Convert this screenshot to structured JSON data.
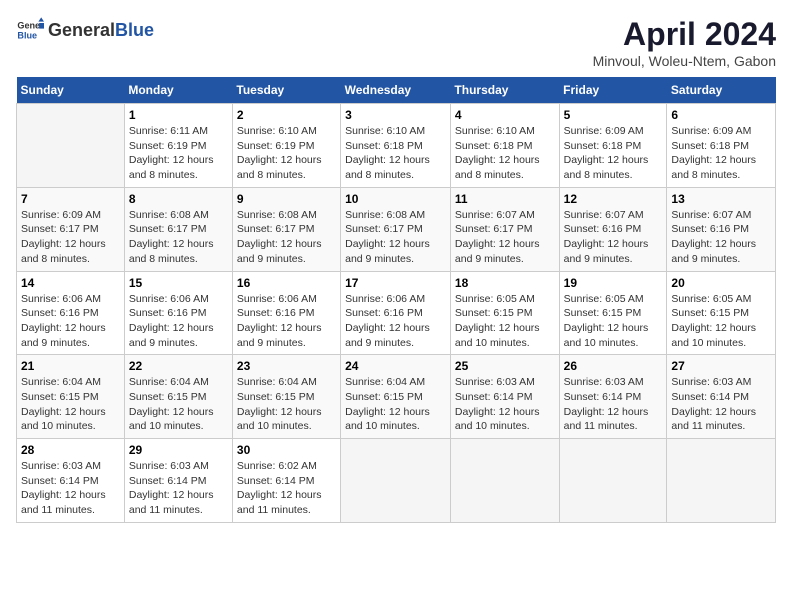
{
  "header": {
    "logo_general": "General",
    "logo_blue": "Blue",
    "title": "April 2024",
    "subtitle": "Minvoul, Woleu-Ntem, Gabon"
  },
  "days_of_week": [
    "Sunday",
    "Monday",
    "Tuesday",
    "Wednesday",
    "Thursday",
    "Friday",
    "Saturday"
  ],
  "weeks": [
    [
      {
        "day": "",
        "sunrise": "",
        "sunset": "",
        "daylight": ""
      },
      {
        "day": "1",
        "sunrise": "Sunrise: 6:11 AM",
        "sunset": "Sunset: 6:19 PM",
        "daylight": "Daylight: 12 hours and 8 minutes."
      },
      {
        "day": "2",
        "sunrise": "Sunrise: 6:10 AM",
        "sunset": "Sunset: 6:19 PM",
        "daylight": "Daylight: 12 hours and 8 minutes."
      },
      {
        "day": "3",
        "sunrise": "Sunrise: 6:10 AM",
        "sunset": "Sunset: 6:18 PM",
        "daylight": "Daylight: 12 hours and 8 minutes."
      },
      {
        "day": "4",
        "sunrise": "Sunrise: 6:10 AM",
        "sunset": "Sunset: 6:18 PM",
        "daylight": "Daylight: 12 hours and 8 minutes."
      },
      {
        "day": "5",
        "sunrise": "Sunrise: 6:09 AM",
        "sunset": "Sunset: 6:18 PM",
        "daylight": "Daylight: 12 hours and 8 minutes."
      },
      {
        "day": "6",
        "sunrise": "Sunrise: 6:09 AM",
        "sunset": "Sunset: 6:18 PM",
        "daylight": "Daylight: 12 hours and 8 minutes."
      }
    ],
    [
      {
        "day": "7",
        "sunrise": "Sunrise: 6:09 AM",
        "sunset": "Sunset: 6:17 PM",
        "daylight": "Daylight: 12 hours and 8 minutes."
      },
      {
        "day": "8",
        "sunrise": "Sunrise: 6:08 AM",
        "sunset": "Sunset: 6:17 PM",
        "daylight": "Daylight: 12 hours and 8 minutes."
      },
      {
        "day": "9",
        "sunrise": "Sunrise: 6:08 AM",
        "sunset": "Sunset: 6:17 PM",
        "daylight": "Daylight: 12 hours and 9 minutes."
      },
      {
        "day": "10",
        "sunrise": "Sunrise: 6:08 AM",
        "sunset": "Sunset: 6:17 PM",
        "daylight": "Daylight: 12 hours and 9 minutes."
      },
      {
        "day": "11",
        "sunrise": "Sunrise: 6:07 AM",
        "sunset": "Sunset: 6:17 PM",
        "daylight": "Daylight: 12 hours and 9 minutes."
      },
      {
        "day": "12",
        "sunrise": "Sunrise: 6:07 AM",
        "sunset": "Sunset: 6:16 PM",
        "daylight": "Daylight: 12 hours and 9 minutes."
      },
      {
        "day": "13",
        "sunrise": "Sunrise: 6:07 AM",
        "sunset": "Sunset: 6:16 PM",
        "daylight": "Daylight: 12 hours and 9 minutes."
      }
    ],
    [
      {
        "day": "14",
        "sunrise": "Sunrise: 6:06 AM",
        "sunset": "Sunset: 6:16 PM",
        "daylight": "Daylight: 12 hours and 9 minutes."
      },
      {
        "day": "15",
        "sunrise": "Sunrise: 6:06 AM",
        "sunset": "Sunset: 6:16 PM",
        "daylight": "Daylight: 12 hours and 9 minutes."
      },
      {
        "day": "16",
        "sunrise": "Sunrise: 6:06 AM",
        "sunset": "Sunset: 6:16 PM",
        "daylight": "Daylight: 12 hours and 9 minutes."
      },
      {
        "day": "17",
        "sunrise": "Sunrise: 6:06 AM",
        "sunset": "Sunset: 6:16 PM",
        "daylight": "Daylight: 12 hours and 9 minutes."
      },
      {
        "day": "18",
        "sunrise": "Sunrise: 6:05 AM",
        "sunset": "Sunset: 6:15 PM",
        "daylight": "Daylight: 12 hours and 10 minutes."
      },
      {
        "day": "19",
        "sunrise": "Sunrise: 6:05 AM",
        "sunset": "Sunset: 6:15 PM",
        "daylight": "Daylight: 12 hours and 10 minutes."
      },
      {
        "day": "20",
        "sunrise": "Sunrise: 6:05 AM",
        "sunset": "Sunset: 6:15 PM",
        "daylight": "Daylight: 12 hours and 10 minutes."
      }
    ],
    [
      {
        "day": "21",
        "sunrise": "Sunrise: 6:04 AM",
        "sunset": "Sunset: 6:15 PM",
        "daylight": "Daylight: 12 hours and 10 minutes."
      },
      {
        "day": "22",
        "sunrise": "Sunrise: 6:04 AM",
        "sunset": "Sunset: 6:15 PM",
        "daylight": "Daylight: 12 hours and 10 minutes."
      },
      {
        "day": "23",
        "sunrise": "Sunrise: 6:04 AM",
        "sunset": "Sunset: 6:15 PM",
        "daylight": "Daylight: 12 hours and 10 minutes."
      },
      {
        "day": "24",
        "sunrise": "Sunrise: 6:04 AM",
        "sunset": "Sunset: 6:15 PM",
        "daylight": "Daylight: 12 hours and 10 minutes."
      },
      {
        "day": "25",
        "sunrise": "Sunrise: 6:03 AM",
        "sunset": "Sunset: 6:14 PM",
        "daylight": "Daylight: 12 hours and 10 minutes."
      },
      {
        "day": "26",
        "sunrise": "Sunrise: 6:03 AM",
        "sunset": "Sunset: 6:14 PM",
        "daylight": "Daylight: 12 hours and 11 minutes."
      },
      {
        "day": "27",
        "sunrise": "Sunrise: 6:03 AM",
        "sunset": "Sunset: 6:14 PM",
        "daylight": "Daylight: 12 hours and 11 minutes."
      }
    ],
    [
      {
        "day": "28",
        "sunrise": "Sunrise: 6:03 AM",
        "sunset": "Sunset: 6:14 PM",
        "daylight": "Daylight: 12 hours and 11 minutes."
      },
      {
        "day": "29",
        "sunrise": "Sunrise: 6:03 AM",
        "sunset": "Sunset: 6:14 PM",
        "daylight": "Daylight: 12 hours and 11 minutes."
      },
      {
        "day": "30",
        "sunrise": "Sunrise: 6:02 AM",
        "sunset": "Sunset: 6:14 PM",
        "daylight": "Daylight: 12 hours and 11 minutes."
      },
      {
        "day": "",
        "sunrise": "",
        "sunset": "",
        "daylight": ""
      },
      {
        "day": "",
        "sunrise": "",
        "sunset": "",
        "daylight": ""
      },
      {
        "day": "",
        "sunrise": "",
        "sunset": "",
        "daylight": ""
      },
      {
        "day": "",
        "sunrise": "",
        "sunset": "",
        "daylight": ""
      }
    ]
  ]
}
